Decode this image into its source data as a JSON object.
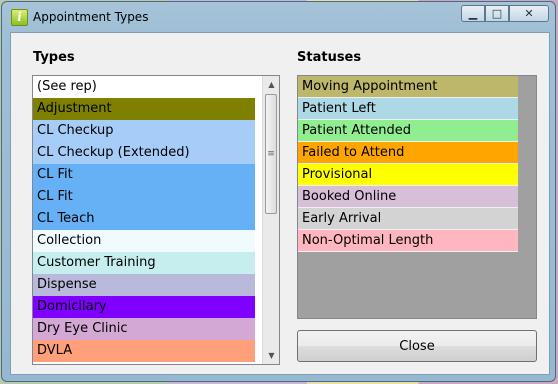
{
  "window": {
    "title": "Appointment Types"
  },
  "caption": {
    "minimize": "▁",
    "maximize": "□",
    "close": "✕"
  },
  "types": {
    "heading": "Types",
    "items": [
      {
        "label": "(See rep)",
        "color": "#ffffff"
      },
      {
        "label": "Adjustment",
        "color": "#808000"
      },
      {
        "label": "CL Checkup",
        "color": "#a6cdf7"
      },
      {
        "label": "CL Checkup (Extended)",
        "color": "#a6cdf7"
      },
      {
        "label": "CL Fit",
        "color": "#66b0f5"
      },
      {
        "label": "CL Fit",
        "color": "#66b0f5"
      },
      {
        "label": "CL Teach",
        "color": "#66b0f5"
      },
      {
        "label": "Collection",
        "color": "#f0fbff"
      },
      {
        "label": "Customer Training",
        "color": "#c6eeee"
      },
      {
        "label": "Dispense",
        "color": "#b9b9dc"
      },
      {
        "label": "Domicilary",
        "color": "#7f00ff"
      },
      {
        "label": "Dry Eye Clinic",
        "color": "#d4a8d4"
      },
      {
        "label": "DVLA",
        "color": "#ffa07a"
      }
    ]
  },
  "statuses": {
    "heading": "Statuses",
    "items": [
      {
        "label": "Moving Appointment",
        "color": "#bdb76b"
      },
      {
        "label": "Patient Left",
        "color": "#add8e6"
      },
      {
        "label": "Patient Attended",
        "color": "#90ee90"
      },
      {
        "label": "Failed to Attend",
        "color": "#ffa500"
      },
      {
        "label": "Provisional",
        "color": "#ffff00"
      },
      {
        "label": "Booked Online",
        "color": "#d8bfd8"
      },
      {
        "label": "Early Arrival",
        "color": "#d3d3d3"
      },
      {
        "label": "Non-Optimal Length",
        "color": "#ffb6c1"
      }
    ]
  },
  "buttons": {
    "close": "Close"
  }
}
